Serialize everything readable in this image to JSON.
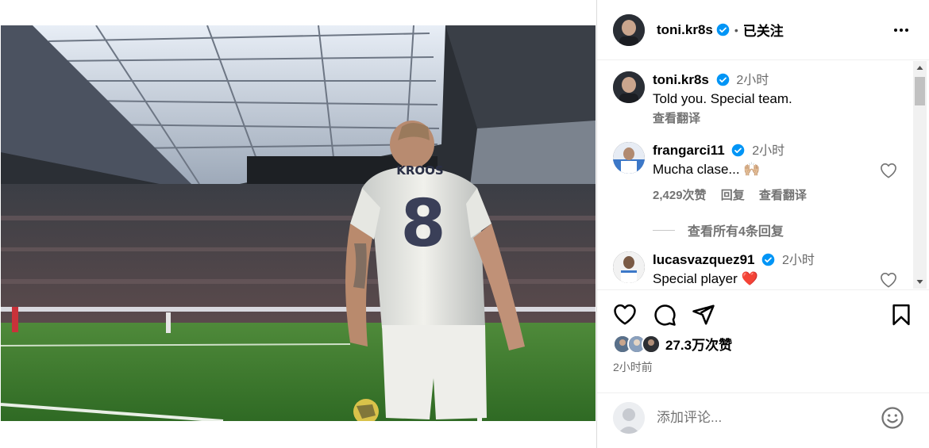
{
  "post": {
    "author": "toni.kr8s",
    "follow_state": "已关注",
    "separator": "•",
    "photo_jersey_name": "KROOS",
    "photo_jersey_number": "8"
  },
  "caption": {
    "user": "toni.kr8s",
    "time": "2小时",
    "text": "Told you. Special team.",
    "translate": "查看翻译"
  },
  "comments": [
    {
      "user": "frangarci11",
      "time": "2小时",
      "text": "Mucha clase... 🙌🏼",
      "likes": "2,429次赞",
      "reply": "回复",
      "translate": "查看翻译"
    },
    {
      "user": "lucasvazquez91",
      "time": "2小时",
      "text": "Special player ❤️"
    }
  ],
  "view_replies": "查看所有4条回复",
  "engagement": {
    "likes_count": "27.3万次赞",
    "posted": "2小时前"
  },
  "composer": {
    "placeholder": "添加评论..."
  },
  "colors": {
    "verified_badge": "#0095f6",
    "heart_red": "#ff3040",
    "muted_text": "#737373"
  },
  "icons": [
    "more-horizontal-icon",
    "verified-badge-icon",
    "heart-icon",
    "comment-icon",
    "share-icon",
    "bookmark-icon",
    "emoji-icon",
    "scroll-up-icon",
    "scroll-down-icon"
  ]
}
